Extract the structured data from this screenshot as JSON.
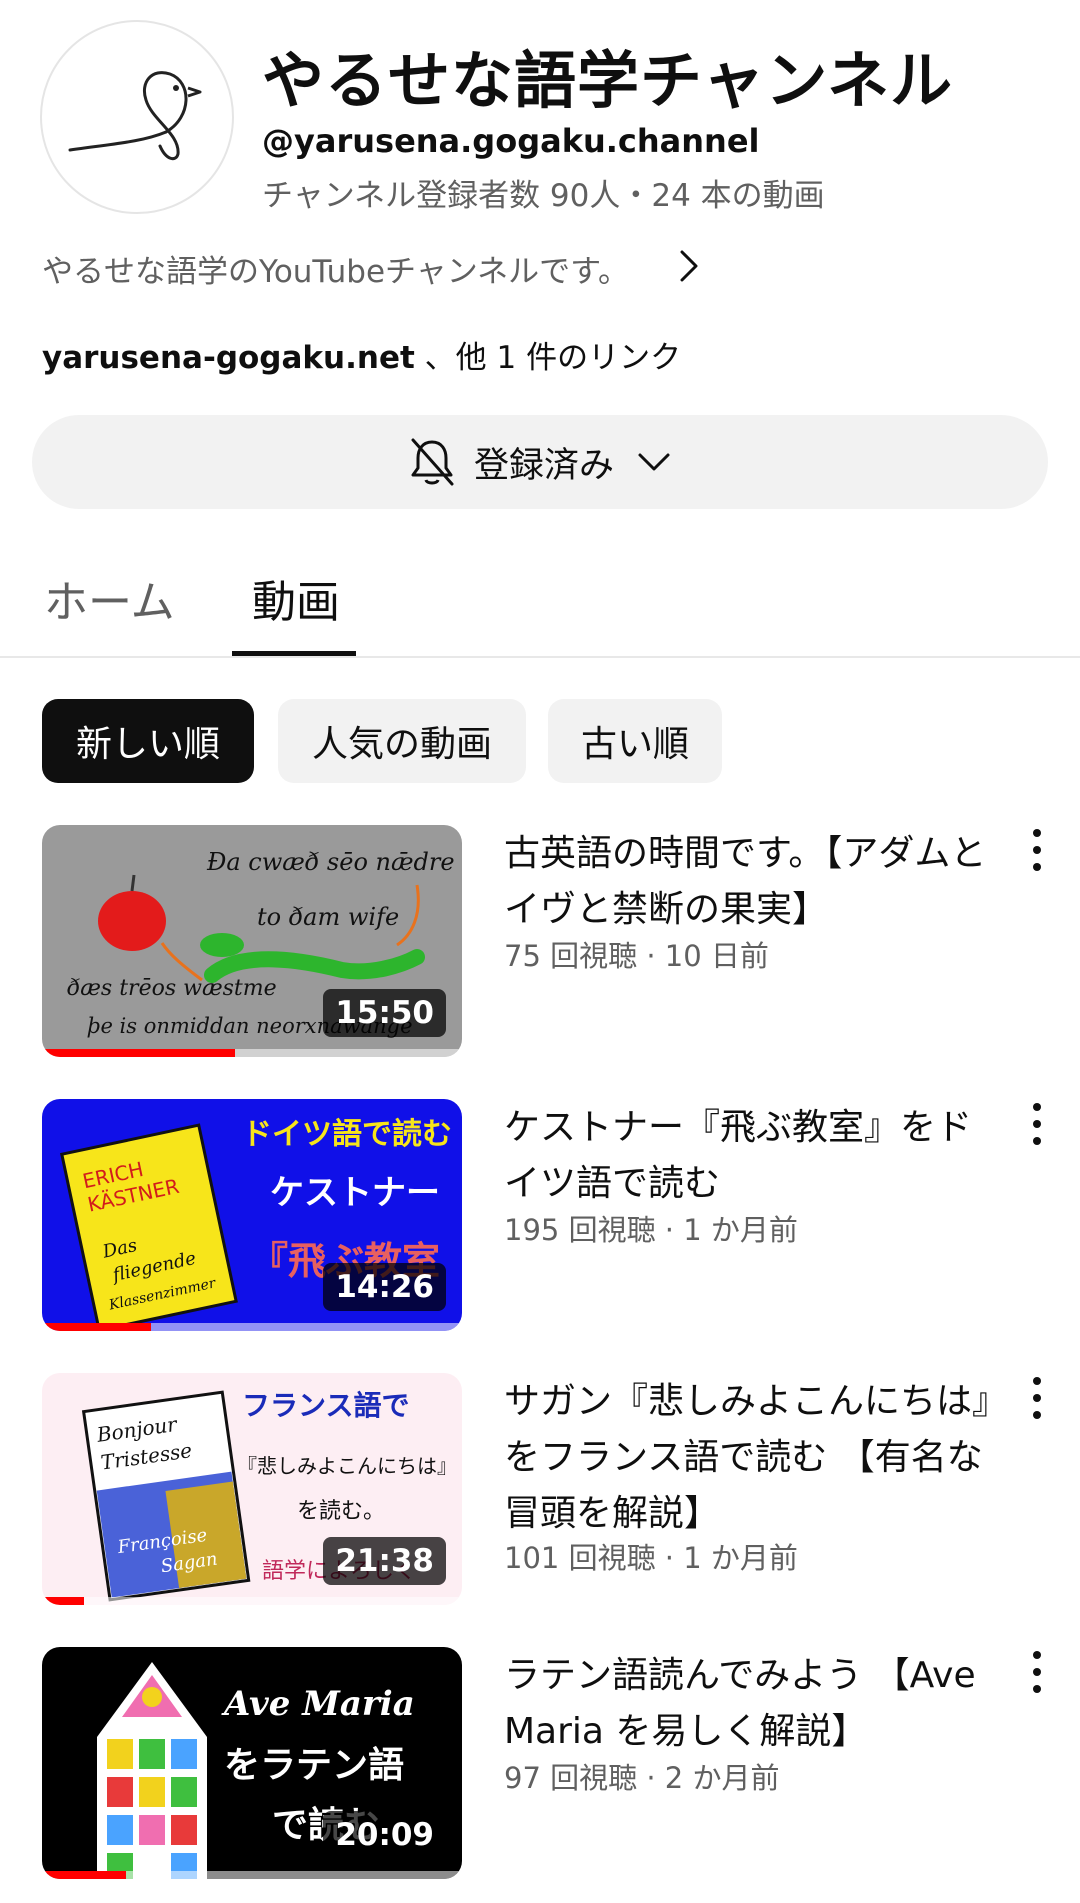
{
  "channel": {
    "name": "やるせな語学チャンネル",
    "handle": "@yarusena.gogaku.channel",
    "stats": "チャンネル登録者数 90人・24 本の動画",
    "description": "やるせな語学のYouTubeチャンネルです。",
    "link_url": "yarusena-gogaku.net",
    "link_suffix": " 、他 1 件のリンク",
    "avatar_icon": "bird-doodle-icon"
  },
  "subscribe": {
    "label": "登録済み",
    "bell_icon": "bell-off-icon",
    "chevron_icon": "chevron-down-icon"
  },
  "tabs": [
    {
      "label": "ホーム",
      "active": false
    },
    {
      "label": "動画",
      "active": true
    }
  ],
  "chips": [
    {
      "label": "新しい順",
      "active": true
    },
    {
      "label": "人気の動画",
      "active": false
    },
    {
      "label": "古い順",
      "active": false
    }
  ],
  "videos": [
    {
      "title": "古英語の時間です。【アダムとイヴと禁断の果実】",
      "meta": "75 回視聴 · 10 日前",
      "duration": "15:50",
      "progress": 0.46,
      "thumb_text": [
        "Đa cwæð sēo nǣdre",
        "to ðam wife",
        "ðæs trēos wæstme",
        "þe is onmiddan neorxnawange"
      ]
    },
    {
      "title": "ケストナー『飛ぶ教室』をドイツ語で読む",
      "meta": "195 回視聴 · 1 か月前",
      "duration": "14:26",
      "progress": 0.26,
      "thumb_text": [
        "ドイツ語で読む",
        "ケストナー",
        "『飛ぶ教室",
        "ERICH",
        "KÄSTNER",
        "Das",
        "fliegende",
        "Klassenzimmer"
      ]
    },
    {
      "title": "サガン『悲しみよこんにちは』をフランス語で読む 【有名な冒頭を解説】",
      "meta": "101 回視聴 · 1 か月前",
      "duration": "21:38",
      "progress": 0.1,
      "thumb_text": [
        "フランス語で",
        "『悲しみよこんにちは』",
        "を読む。",
        "語学によろしく",
        "Bonjour",
        "Tristesse",
        "Françoise",
        "Sagan"
      ]
    },
    {
      "title": "ラテン語読んでみよう 【Ave Maria を易しく解説】",
      "meta": "97 回視聴 · 2 か月前",
      "duration": "20:09",
      "progress": 0.2,
      "thumb_text": [
        "Ave Maria",
        "をラテン語",
        "で読む"
      ]
    }
  ],
  "colors": {
    "accent_red": "#ff0000",
    "chip_active_bg": "#0f0f0f",
    "chip_bg": "#f2f2f2",
    "muted_text": "#606060"
  }
}
